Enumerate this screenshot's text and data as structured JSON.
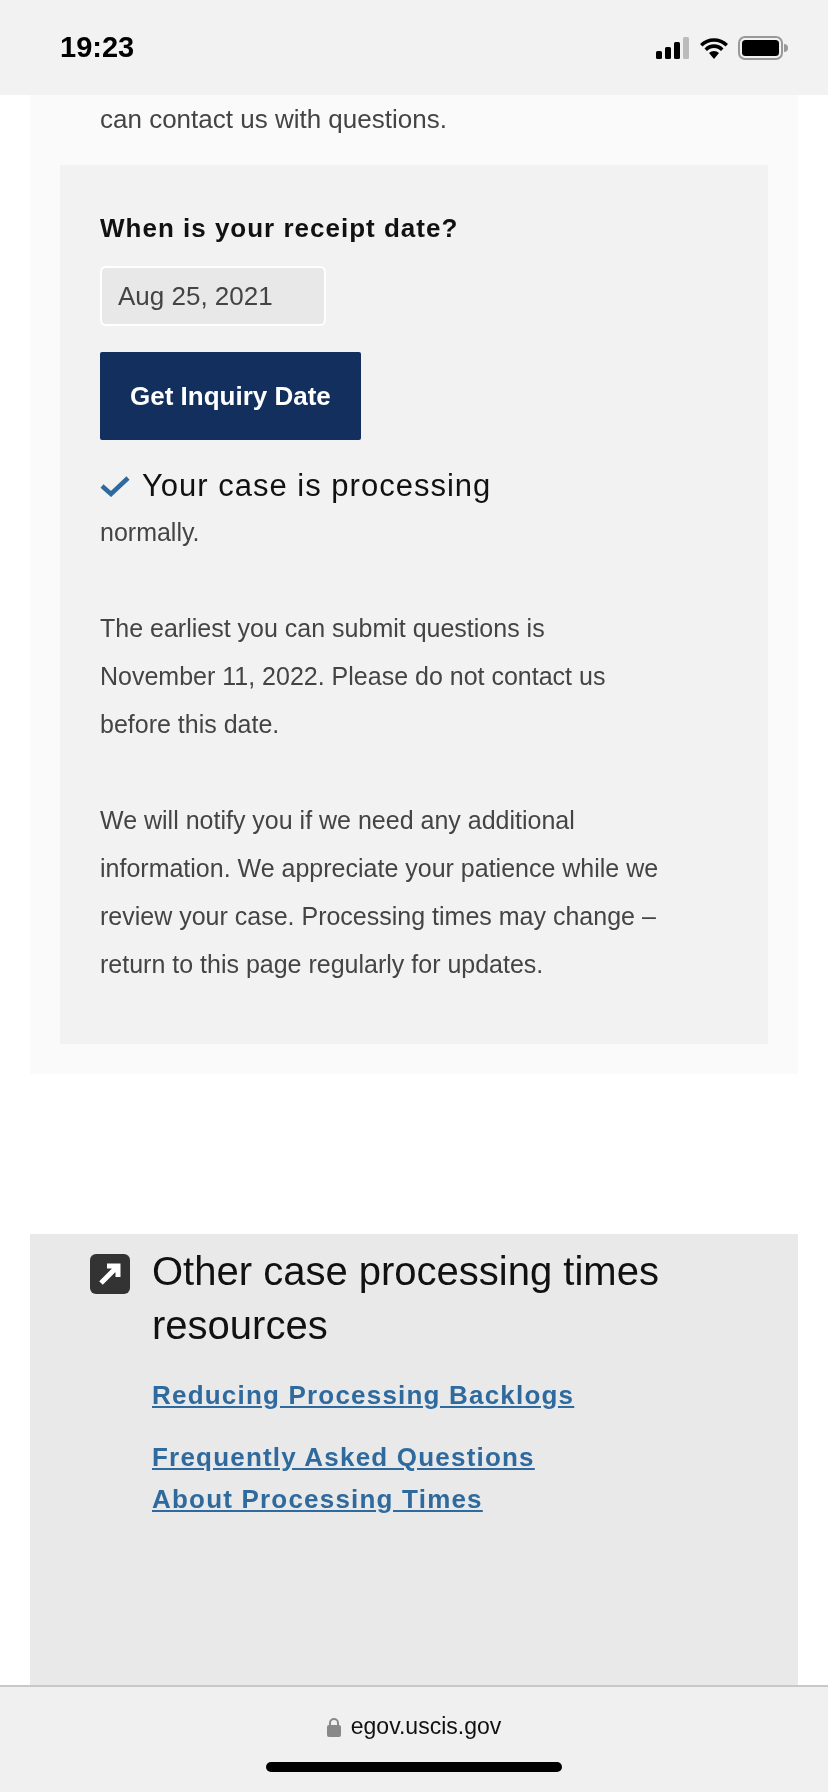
{
  "status_bar": {
    "time": "19:23"
  },
  "intro_fragment": "can contact us with questions.",
  "inquiry": {
    "question": "When is your receipt date?",
    "date_field": {
      "value": "Aug 25, 2021"
    },
    "button": "Get Inquiry Date",
    "result": {
      "status_title": "Your case is processing",
      "status_rest": "normally.",
      "paragraphs": [
        "The earliest you can submit questions is November 11, 2022. Please do not contact us before this date.",
        "We will notify you if we need any additional information. We appreciate your patience while we review your case. Processing times may change – return to this page regularly for updates."
      ]
    }
  },
  "resources": {
    "title": "Other case processing times resources",
    "links": [
      "Reducing Processing Backlogs",
      "Frequently Asked Questions About Processing Times"
    ]
  },
  "browser_bar": {
    "url": "egov.uscis.gov"
  }
}
